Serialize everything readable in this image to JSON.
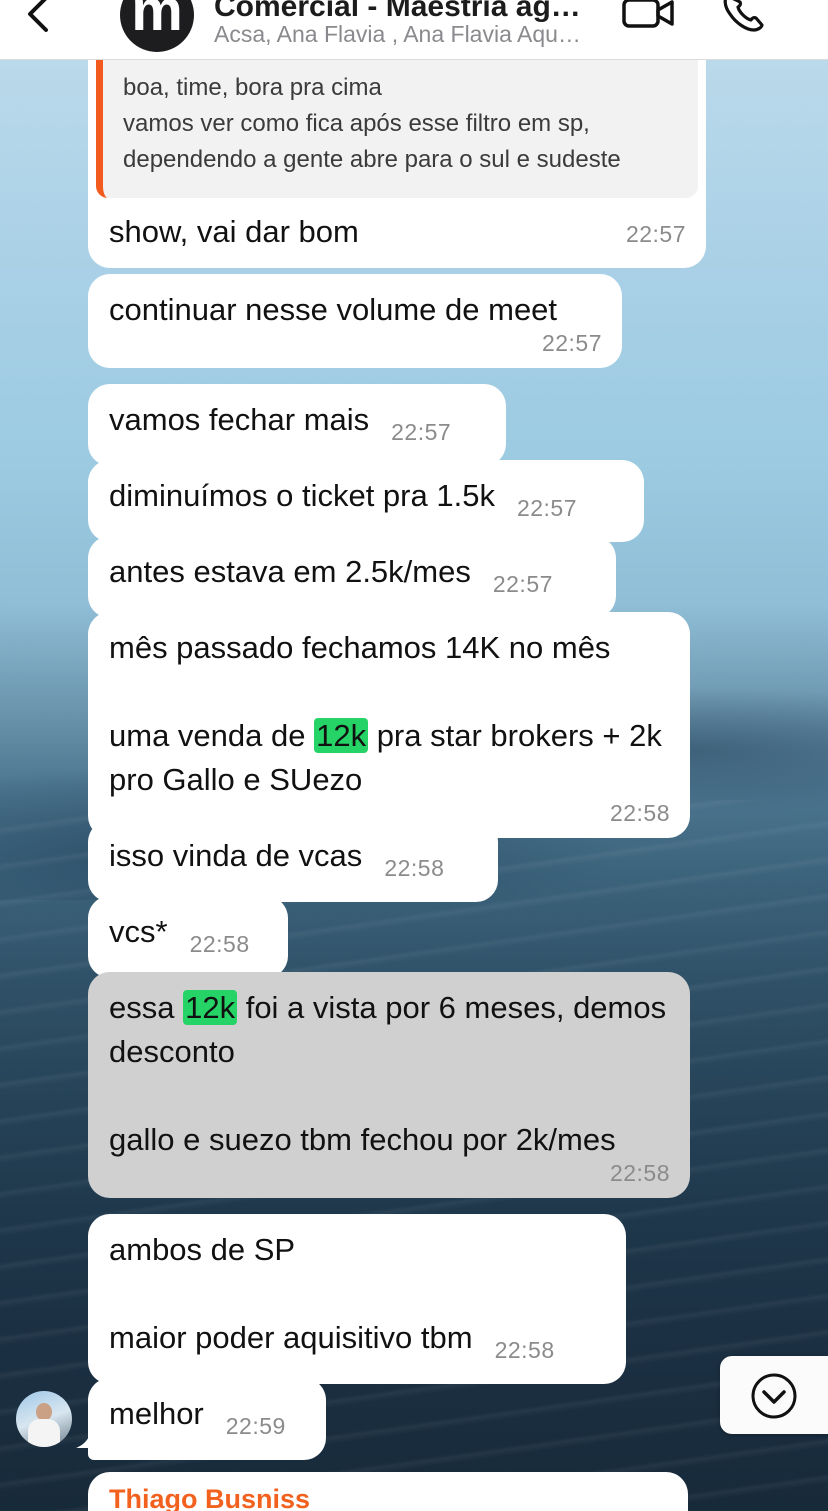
{
  "header": {
    "group_avatar_letter": "m",
    "title": "Comercial - Maestria ag…",
    "subtitle": "Acsa, Ana Flavia , Ana Flavia Aqu…",
    "icons": [
      "back-chevron-icon",
      "video-call-icon",
      "phone-call-icon"
    ]
  },
  "quoted": {
    "text": "boa, time, bora pra cima\nvamos ver como fica após esse filtro em sp,\ndependendo a gente abre para o sul e sudeste",
    "accent": "#f25a1e"
  },
  "messages": [
    {
      "text": "show, vai dar bom",
      "time": "22:57"
    },
    {
      "text": "continuar nesse volume de meet",
      "time": "22:57"
    },
    {
      "text": "vamos fechar mais",
      "time": "22:57"
    },
    {
      "text": "diminuímos o ticket pra 1.5k",
      "time": "22:57"
    },
    {
      "text": "antes estava em 2.5k/mes",
      "time": "22:57"
    },
    {
      "text_a": "mês passado fechamos 14K no mês\n\numa venda de ",
      "highlight": "12k",
      "text_b": " pra star brokers + 2k pro Gallo e SUezo",
      "time": "22:58"
    },
    {
      "text": "isso vinda de vcas",
      "time": "22:58"
    },
    {
      "text": "vcs*",
      "time": "22:58"
    },
    {
      "text_a": "essa ",
      "highlight": "12k",
      "text_b": " foi a vista por 6 meses, demos desconto\n\ngallo e suezo tbm fechou por 2k/mes",
      "time": "22:58",
      "selected": true
    },
    {
      "text": "ambos de SP\n\nmaior poder aquisitivo tbm",
      "time": "22:58"
    },
    {
      "text": "melhor",
      "time": "22:59"
    }
  ],
  "next_message": {
    "sender": "Thiago Busniss"
  },
  "colors": {
    "highlight": "#25d366",
    "bubble": "#ffffff",
    "selected_bubble": "#d0d0d0",
    "sender_name": "#f2611e"
  }
}
